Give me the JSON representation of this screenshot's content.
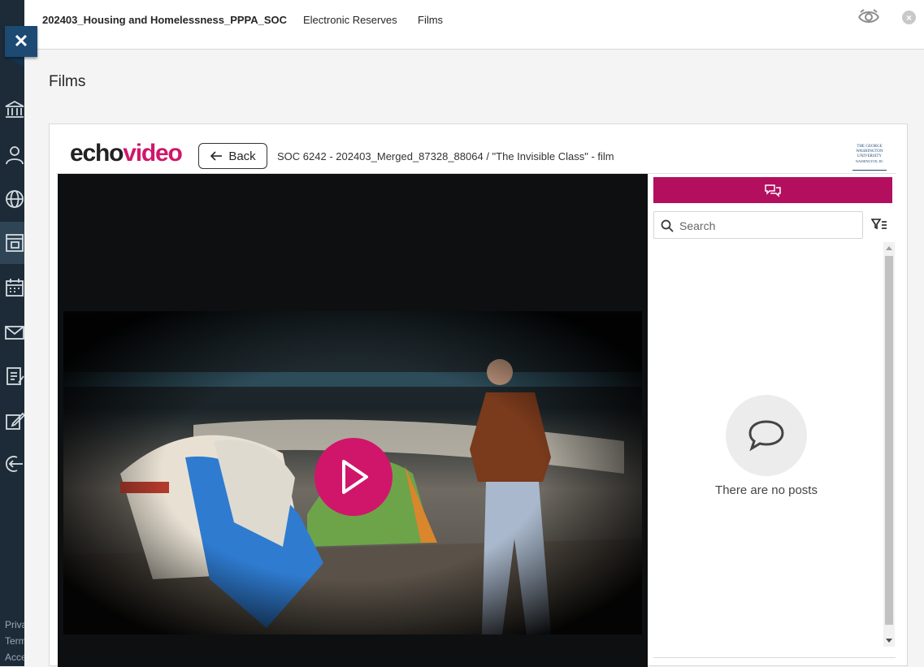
{
  "leftnav": {
    "footer": [
      "Priva",
      "Term",
      "Acce"
    ]
  },
  "topbar": {
    "course_title": "202403_Housing and Homelessness_PPPA_SOC",
    "crumbs": [
      "Electronic Reserves",
      "Films"
    ]
  },
  "page": {
    "title": "Films"
  },
  "echo": {
    "logo_echo": "echo",
    "logo_video": "video",
    "back_label": "Back",
    "breadcrumb": "SOC 6242 - 202403_Merged_87328_88064 / \"The Invisible Class\" - film",
    "university_logo": [
      "THE GEORGE",
      "WASHINGTON",
      "UNIVERSITY",
      "WASHINGTON, DC"
    ]
  },
  "sidebar": {
    "search_placeholder": "Search",
    "empty_message": "There are no posts"
  },
  "colors": {
    "nav_bg": "#1c2b37",
    "echo_accent": "#d0166a",
    "chat_tab": "#b30f5e"
  }
}
